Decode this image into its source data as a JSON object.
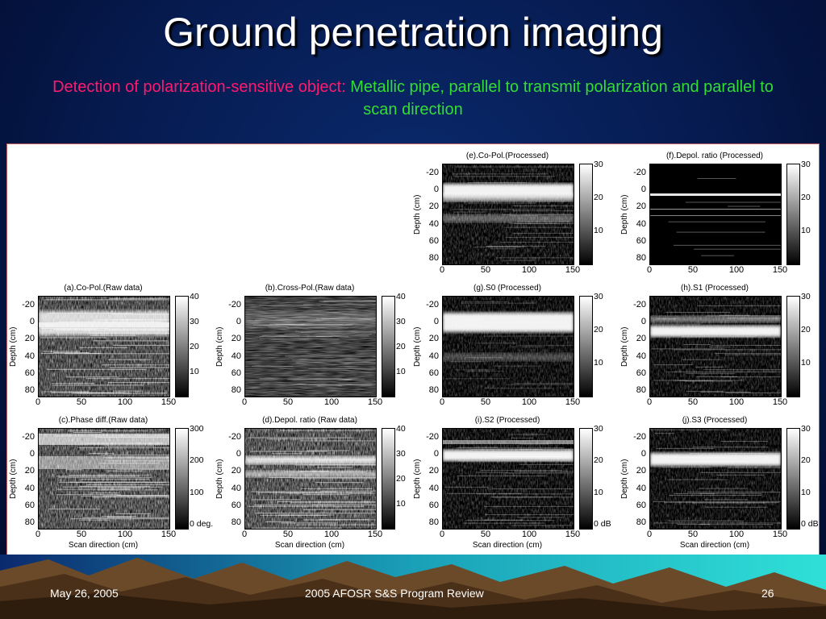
{
  "slide": {
    "title": "Ground penetration imaging",
    "subtitle_red": "Detection of polarization-sensitive object:",
    "subtitle_green": "Metallic pipe, parallel to transmit polarization and parallel to scan direction",
    "footer": {
      "date": "May 26, 2005",
      "center": "2005 AFOSR S&S Program Review",
      "page": "26"
    }
  },
  "colors": {
    "background": "#061a4e",
    "title": "#ffffff",
    "subtitle_red": "#ff1a6e",
    "subtitle_green": "#33dd33",
    "figure_border": "#c06060"
  },
  "figure": {
    "x_ticks": [
      "0",
      "50",
      "100",
      "150"
    ],
    "y_ticks": [
      "-20",
      "0",
      "20",
      "40",
      "60",
      "80"
    ],
    "ylabel": "Depth (cm)",
    "xlabel": "Scan direction (cm)",
    "panels": [
      {
        "id": "e",
        "title": "(e).Co-Pol.(Processed)",
        "cbar": [
          "30",
          "20",
          "10"
        ],
        "tex": "texE",
        "x_ticks": true,
        "ylabel": true,
        "xlabel": false
      },
      {
        "id": "f",
        "title": "(f).Depol. ratio (Processed)",
        "cbar": [
          "30",
          "20",
          "10"
        ],
        "tex": "texF",
        "x_ticks": true,
        "ylabel": true,
        "xlabel": false
      },
      {
        "id": "a",
        "title": "(a).Co-Pol.(Raw data)",
        "cbar": [
          "40",
          "30",
          "20",
          "10"
        ],
        "tex": "texA",
        "x_ticks": true,
        "ylabel": true,
        "xlabel": false
      },
      {
        "id": "b",
        "title": "(b).Cross-Pol.(Raw data)",
        "cbar": [
          "40",
          "30",
          "20",
          "10"
        ],
        "tex": "texB",
        "x_ticks": true,
        "ylabel": true,
        "xlabel": false
      },
      {
        "id": "g",
        "title": "(g).S0 (Processed)",
        "cbar": [
          "30",
          "20",
          "10"
        ],
        "tex": "texG",
        "x_ticks": true,
        "ylabel": true,
        "xlabel": false
      },
      {
        "id": "h",
        "title": "(h).S1 (Processed)",
        "cbar": [
          "30",
          "20",
          "10"
        ],
        "tex": "texH",
        "x_ticks": true,
        "ylabel": true,
        "xlabel": false
      },
      {
        "id": "c",
        "title": "(c).Phase diff.(Raw data)",
        "cbar": [
          "300",
          "200",
          "100",
          "0 deg."
        ],
        "tex": "texC",
        "x_ticks": true,
        "ylabel": true,
        "xlabel": true
      },
      {
        "id": "d",
        "title": "(d).Depol. ratio (Raw data)",
        "cbar": [
          "40",
          "30",
          "20",
          "10"
        ],
        "tex": "texD",
        "x_ticks": true,
        "ylabel": true,
        "xlabel": true
      },
      {
        "id": "i",
        "title": "(i).S2 (Processed)",
        "cbar": [
          "30",
          "20",
          "10",
          "0 dB"
        ],
        "tex": "texI",
        "x_ticks": true,
        "ylabel": true,
        "xlabel": true
      },
      {
        "id": "j",
        "title": "(j).S3 (Processed)",
        "cbar": [
          "30",
          "20",
          "10",
          "0 dB"
        ],
        "tex": "texJ",
        "x_ticks": true,
        "ylabel": true,
        "xlabel": true
      }
    ]
  }
}
